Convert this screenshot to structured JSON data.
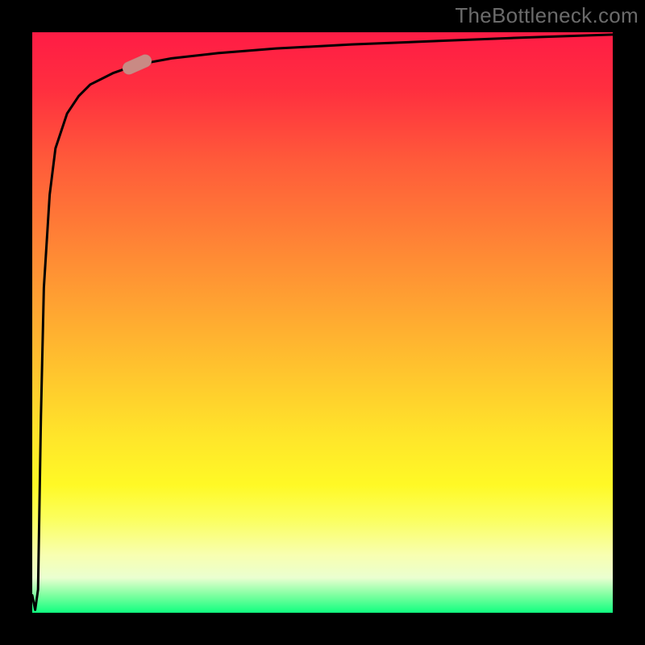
{
  "watermark": "TheBottleneck.com",
  "chart_data": {
    "type": "line",
    "title": "",
    "xlabel": "",
    "ylabel": "",
    "xlim": [
      0,
      100
    ],
    "ylim": [
      0,
      100
    ],
    "grid": false,
    "legend": false,
    "series": [
      {
        "name": "curve",
        "x": [
          0,
          0.5,
          1.0,
          1.5,
          2,
          3,
          4,
          6,
          8,
          10,
          14,
          18,
          24,
          32,
          42,
          55,
          70,
          85,
          100
        ],
        "values": [
          3,
          0.5,
          4,
          34,
          56,
          72,
          80,
          86,
          89,
          91,
          93,
          94.4,
          95.5,
          96.4,
          97.2,
          97.9,
          98.5,
          99.1,
          99.6
        ]
      }
    ],
    "marker": {
      "x": 18,
      "y": 94.4
    },
    "background_gradient": {
      "top": "#ff1c45",
      "mid_upper": "#ffa032",
      "mid_lower": "#fff926",
      "bottom": "#10ff80"
    }
  }
}
